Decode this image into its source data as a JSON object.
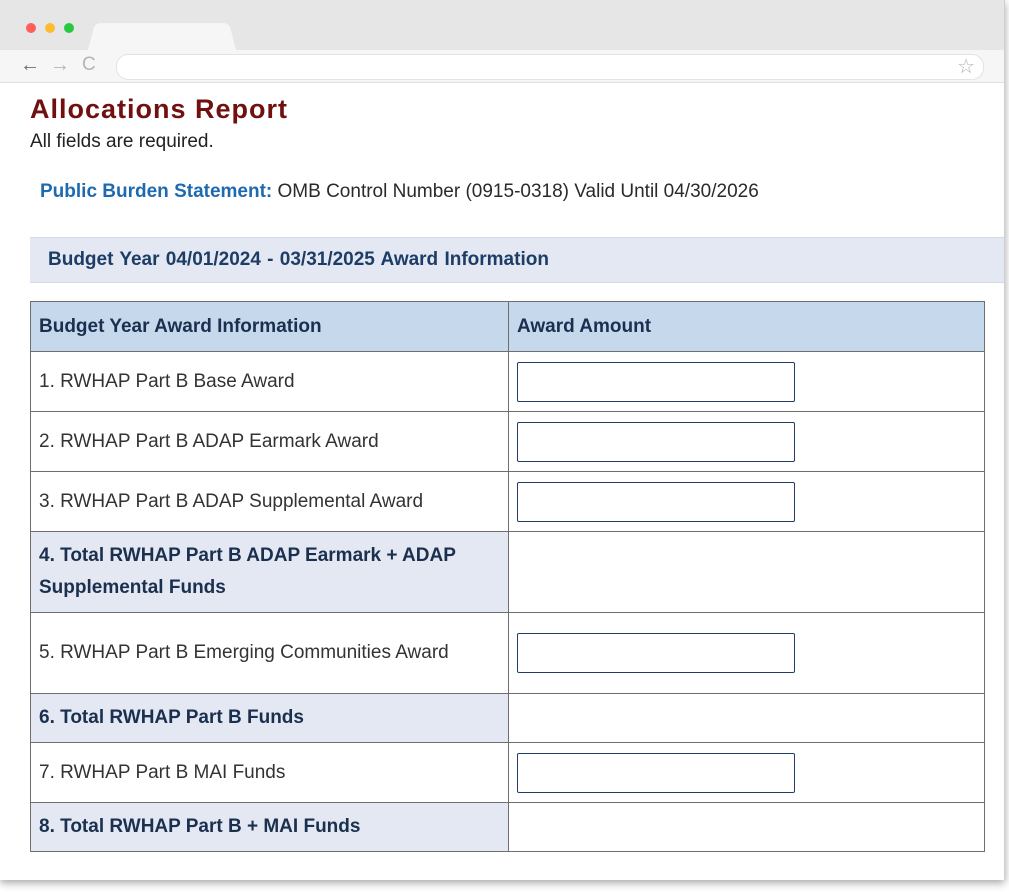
{
  "browser": {
    "window_controls": [
      "close",
      "minimize",
      "maximize"
    ],
    "nav": {
      "back_icon": "arrow-left-icon",
      "forward_icon": "arrow-right-icon",
      "reload_icon": "reload-icon"
    },
    "url": "",
    "bookmark_icon": "star-icon"
  },
  "page": {
    "title": "Allocations Report",
    "required_note": "All fields are required.",
    "burden_label": "Public Burden Statement:",
    "burden_text": " OMB Control Number (0915-0318) Valid Until 04/30/2026",
    "section_title": "Budget Year 04/01/2024 - 03/31/2025  Award Information"
  },
  "table": {
    "headers": [
      "Budget Year Award Information",
      "Award Amount"
    ],
    "rows": [
      {
        "label": "1. RWHAP Part B Base Award",
        "input_value": ""
      },
      {
        "label": "2. RWHAP Part B ADAP Earmark Award",
        "input_value": ""
      },
      {
        "label": "3. RWHAP Part B ADAP Supplemental Award",
        "input_value": ""
      },
      {
        "label": "4. Total RWHAP Part B ADAP Earmark + ADAP Supplemental Funds"
      },
      {
        "label": "5. RWHAP Part B Emerging Communities Award",
        "input_value": ""
      },
      {
        "label": "6. Total RWHAP Part B Funds"
      },
      {
        "label": "7. RWHAP Part B MAI Funds",
        "input_value": ""
      },
      {
        "label": "8. Total RWHAP Part B + MAI Funds"
      }
    ]
  },
  "colors": {
    "title": "#701010",
    "burden_label": "#1e6ab0",
    "header_bg": "#c6d9ec",
    "total_row_bg": "#e3e8f2",
    "input_border": "#233d66"
  }
}
